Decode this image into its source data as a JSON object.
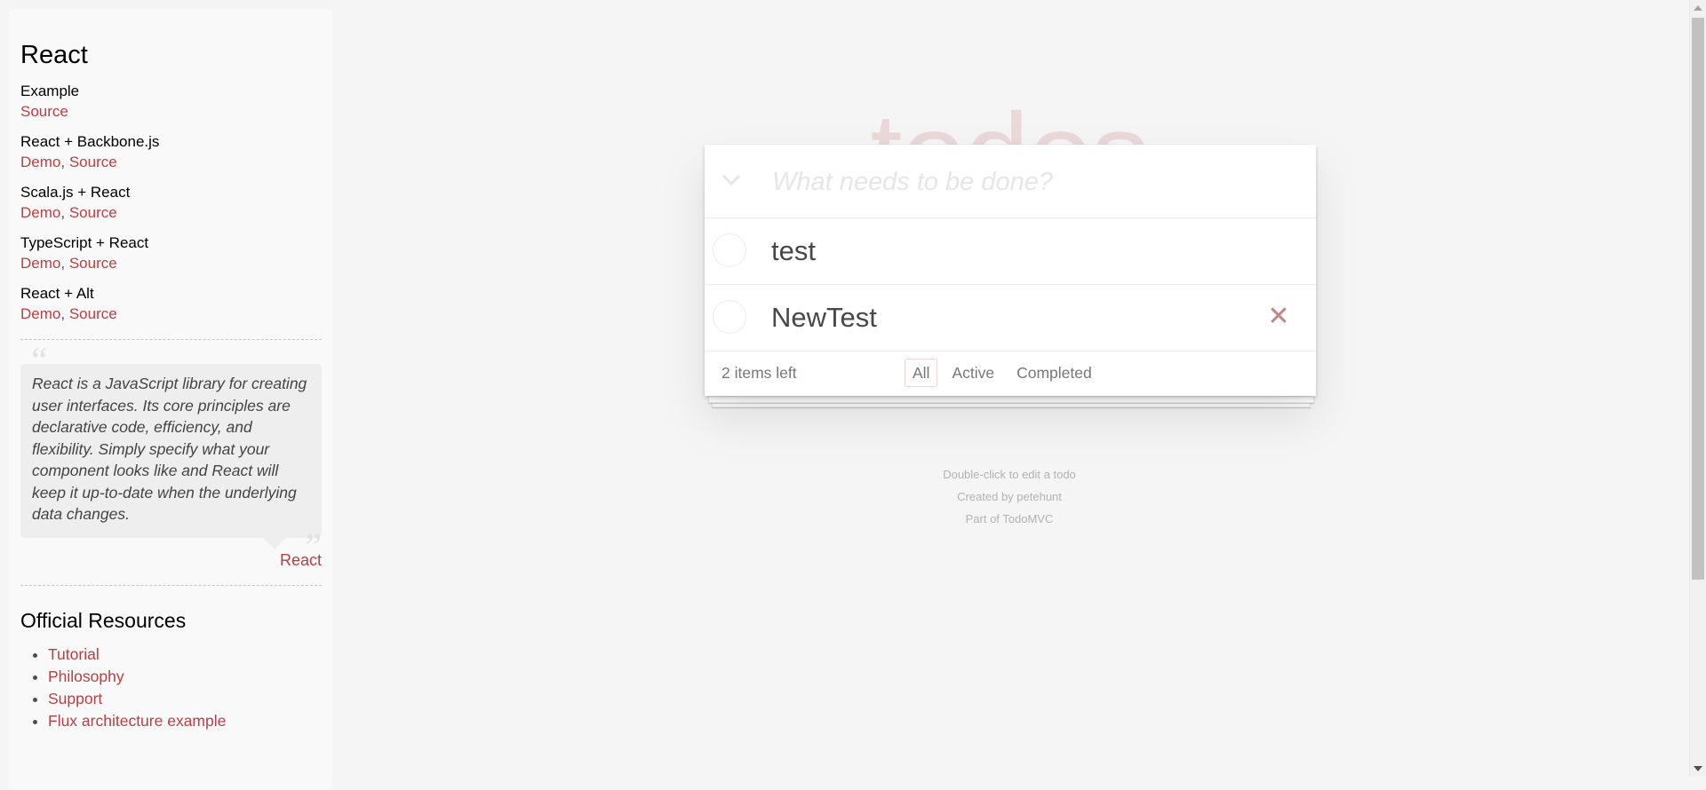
{
  "sidebar": {
    "title": "React",
    "examples": [
      {
        "name": "Example",
        "links": [
          "Source"
        ]
      },
      {
        "name": "React + Backbone.js",
        "links": [
          "Demo",
          "Source"
        ]
      },
      {
        "name": "Scala.js + React",
        "links": [
          "Demo",
          "Source"
        ]
      },
      {
        "name": "TypeScript + React",
        "links": [
          "Demo",
          "Source"
        ]
      },
      {
        "name": "React + Alt",
        "links": [
          "Demo",
          "Source"
        ]
      }
    ],
    "separator": ",",
    "quote": "React is a JavaScript library for creating user interfaces. Its core principles are declarative code, efficiency, and flexibility. Simply specify what your component looks like and React will keep it up-to-date when the underlying data changes.",
    "quote_source": "React",
    "resources_title": "Official Resources",
    "resources": [
      "Tutorial",
      "Philosophy",
      "Support",
      "Flux architecture example"
    ]
  },
  "app": {
    "title": "todos",
    "new_todo_placeholder": "What needs to be done?",
    "toggle_all_icon": "chevron-down-icon",
    "todos": [
      {
        "label": "test",
        "completed": false
      },
      {
        "label": "NewTest",
        "completed": false
      }
    ],
    "footer": {
      "count": "2 items left",
      "filters": [
        "All",
        "Active",
        "Completed"
      ],
      "selected_filter": "All"
    }
  },
  "info": {
    "edit_hint": "Double-click to edit a todo",
    "created_by": "Created by petehunt",
    "part_of": "Part of TodoMVC"
  },
  "colors": {
    "accent": "#b83f45",
    "background": "#f5f5f5",
    "title": "#ecdede"
  }
}
